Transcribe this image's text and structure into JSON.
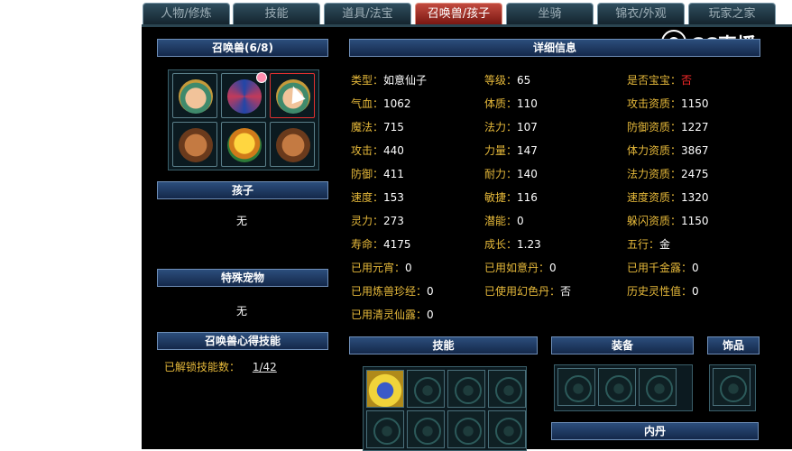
{
  "tabs": [
    {
      "label": "人物/修炼"
    },
    {
      "label": "技能"
    },
    {
      "label": "道具/法宝"
    },
    {
      "label": "召唤兽/孩子"
    },
    {
      "label": "坐骑"
    },
    {
      "label": "锦衣/外观"
    },
    {
      "label": "玩家之家"
    }
  ],
  "active_tab": "召唤兽/孩子",
  "logo": {
    "text": "CC直播",
    "icon": "cc-logo-icon"
  },
  "left": {
    "summon_header": "召唤兽(6/8)",
    "pets": [
      {
        "icon": "green-hair-girl-avatar"
      },
      {
        "icon": "red-blue-fan-avatar"
      },
      {
        "icon": "green-hair-girl-avatar"
      },
      {
        "icon": "ogre-avatar"
      },
      {
        "icon": "golden-warrior-avatar"
      },
      {
        "icon": "ogre-avatar"
      }
    ],
    "child_header": "孩子",
    "child_value": "无",
    "special_header": "特殊宠物",
    "special_value": "无",
    "skill_header": "召唤兽心得技能",
    "unlock_label": "已解锁技能数：",
    "unlock_value": "1/42"
  },
  "detail": {
    "header": "详细信息",
    "rows": [
      [
        {
          "k": "类型：",
          "v": "如意仙子"
        },
        {
          "k": "等级：",
          "v": "65"
        },
        {
          "k": "是否宝宝：",
          "v": "否",
          "red": true
        }
      ],
      [
        {
          "k": "气血：",
          "v": "1062"
        },
        {
          "k": "体质：",
          "v": "110"
        },
        {
          "k": "攻击资质：",
          "v": "1150"
        }
      ],
      [
        {
          "k": "魔法：",
          "v": "715"
        },
        {
          "k": "法力：",
          "v": "107"
        },
        {
          "k": "防御资质：",
          "v": "1227"
        }
      ],
      [
        {
          "k": "攻击：",
          "v": "440"
        },
        {
          "k": "力量：",
          "v": "147"
        },
        {
          "k": "体力资质：",
          "v": "3867"
        }
      ],
      [
        {
          "k": "防御：",
          "v": "411"
        },
        {
          "k": "耐力：",
          "v": "140"
        },
        {
          "k": "法力资质：",
          "v": "2475"
        }
      ],
      [
        {
          "k": "速度：",
          "v": "153"
        },
        {
          "k": "敏捷：",
          "v": "116"
        },
        {
          "k": "速度资质：",
          "v": "1320"
        }
      ],
      [
        {
          "k": "灵力：",
          "v": "273"
        },
        {
          "k": "潜能：",
          "v": "0"
        },
        {
          "k": "躲闪资质：",
          "v": "1150"
        }
      ],
      [
        {
          "k": "寿命：",
          "v": "4175"
        },
        {
          "k": "成长：",
          "v": "1.23"
        },
        {
          "k": "五行：",
          "v": "金"
        }
      ],
      [
        {
          "k": "已用元宵：",
          "v": "0"
        },
        {
          "k": "已用如意丹：",
          "v": "0"
        },
        {
          "k": "已用千金露：",
          "v": "0"
        }
      ],
      [
        {
          "k": "已用炼兽珍经：",
          "v": "0"
        },
        {
          "k": "已使用幻色丹：",
          "v": "否"
        },
        {
          "k": "历史灵性值：",
          "v": "0"
        }
      ],
      [
        {
          "k": "已用清灵仙露：",
          "v": "0"
        }
      ]
    ]
  },
  "bottom": {
    "skills_header": "技能",
    "equip_header": "装备",
    "accessory_header": "饰品",
    "core_header": "内丹",
    "skill_icon": "water-flame-skill-icon"
  }
}
